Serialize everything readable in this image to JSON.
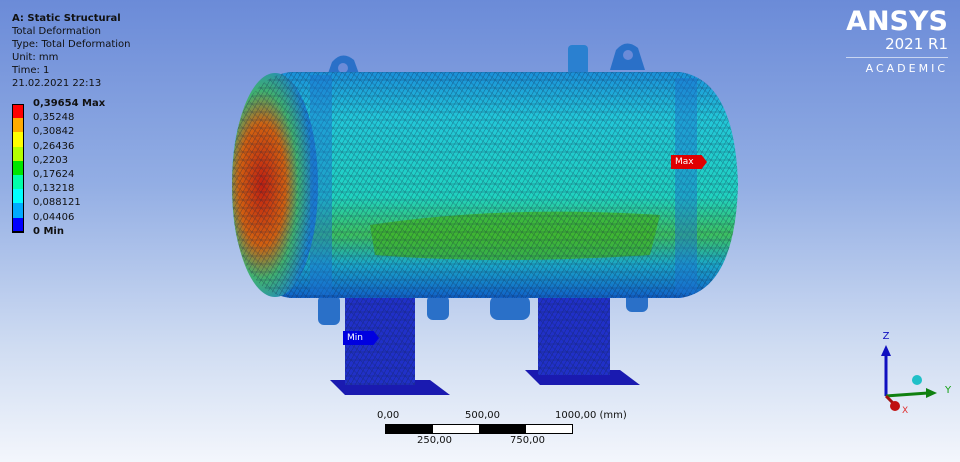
{
  "info": {
    "title": "A: Static Structural",
    "lines": [
      "Total Deformation",
      "Type: Total Deformation",
      "Unit: mm",
      "Time: 1",
      "21.02.2021 22:13"
    ]
  },
  "legend": {
    "entries": [
      {
        "label": "0,39654 Max",
        "color": "#ff0000"
      },
      {
        "label": "0,35248",
        "color": "#ffaa00"
      },
      {
        "label": "0,30842",
        "color": "#ffff00"
      },
      {
        "label": "0,26436",
        "color": "#b4ff00"
      },
      {
        "label": "0,2203",
        "color": "#00e600"
      },
      {
        "label": "0,17624",
        "color": "#00ffaa"
      },
      {
        "label": "0,13218",
        "color": "#00ffff"
      },
      {
        "label": "0,088121",
        "color": "#00aaff"
      },
      {
        "label": "0,04406",
        "color": "#0000ff"
      },
      {
        "label": "0 Min",
        "color": null
      }
    ]
  },
  "logo": {
    "brand": "ANSYS",
    "version": "2021 R1",
    "edition": "ACADEMIC"
  },
  "probes": {
    "max": "Max",
    "min": "Min"
  },
  "scale": {
    "top": [
      "0,00",
      "500,00",
      "1000,00 (mm)"
    ],
    "bottom": [
      "250,00",
      "750,00"
    ]
  },
  "triad": {
    "x": "X",
    "y": "Y",
    "z": "Z"
  }
}
